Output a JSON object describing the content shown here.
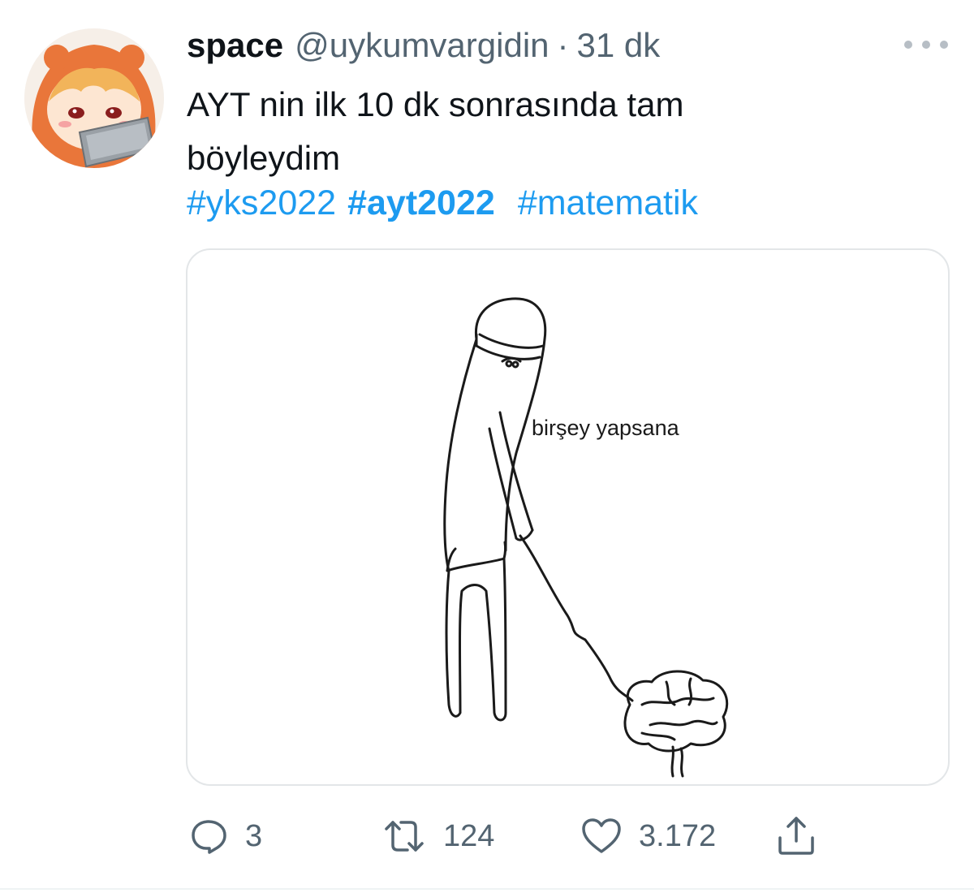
{
  "tweet": {
    "display_name": "space",
    "handle": "@uykumvargidin",
    "separator": "·",
    "time": "31 dk",
    "text_line1": "AYT nin ilk 10 dk sonrasında tam",
    "text_line2": "böyleydim",
    "hashtags": [
      "#yks2022",
      "#ayt2022",
      "#matematik"
    ],
    "media_caption": "birşey yapsana",
    "counts": {
      "replies": "3",
      "retweets": "124",
      "likes": "3.172"
    }
  },
  "icons": {
    "more": "more-horizontal-icon",
    "reply": "reply-bubble-icon",
    "retweet": "retweet-icon",
    "like": "heart-icon",
    "share": "share-icon"
  },
  "colors": {
    "text": "#0f1419",
    "secondary": "#536471",
    "link": "#1d9bf0",
    "border": "#e3e6e8"
  }
}
